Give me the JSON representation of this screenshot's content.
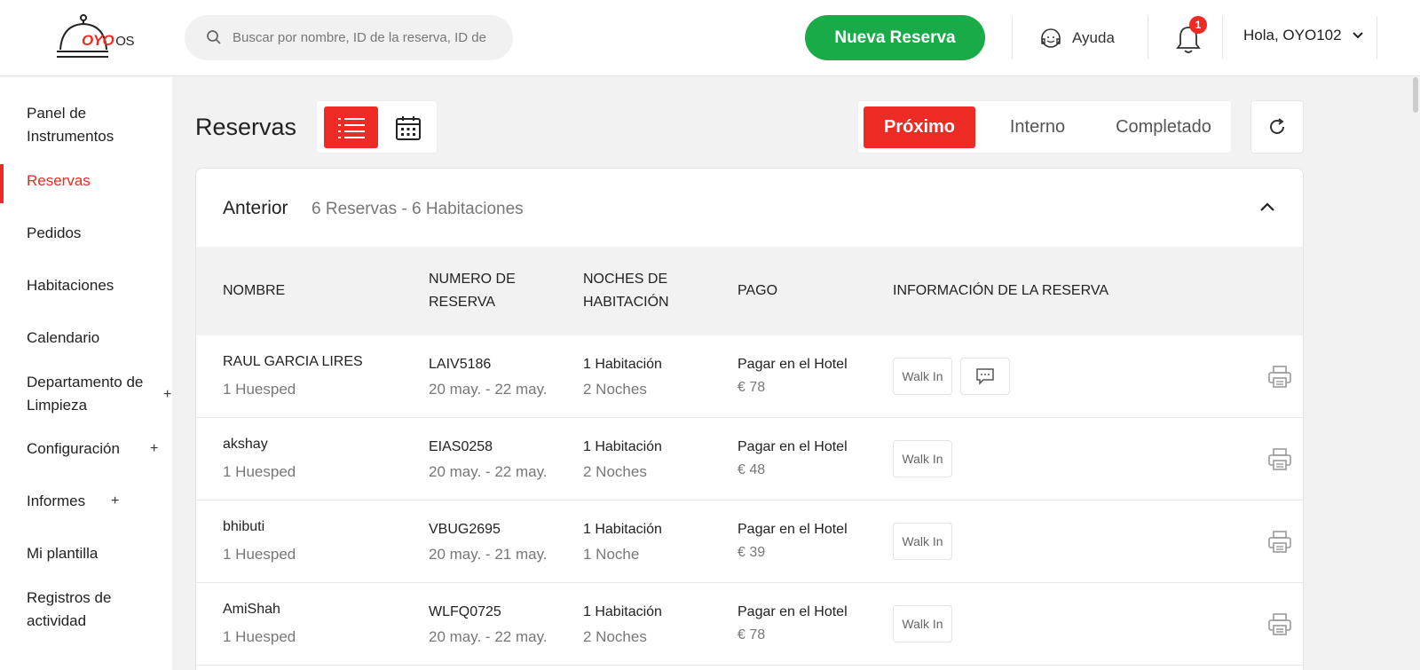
{
  "header": {
    "logo_brand": "OYO",
    "logo_suffix": "OS",
    "search_placeholder": "Buscar por nombre, ID de la reserva, ID de",
    "new_booking_label": "Nueva Reserva",
    "help_label": "Ayuda",
    "notification_count": "1",
    "user_greeting": "Hola, OYO102"
  },
  "sidebar": {
    "items": [
      {
        "label": "Panel de Instrumentos"
      },
      {
        "label": "Reservas"
      },
      {
        "label": "Pedidos"
      },
      {
        "label": "Habitaciones"
      },
      {
        "label": "Calendario"
      },
      {
        "label": "Departamento de Limpieza",
        "expand": "+"
      },
      {
        "label": "Configuración",
        "expand": "+"
      },
      {
        "label": "Informes",
        "expand": "+"
      },
      {
        "label": "Mi plantilla"
      },
      {
        "label": "Registros de actividad"
      }
    ]
  },
  "main": {
    "title": "Reservas",
    "tabs": [
      "Próximo",
      "Interno",
      "Completado"
    ],
    "section_title": "Anterior",
    "section_summary": "6 Reservas - 6 Habitaciones",
    "columns": [
      "NOMBRE",
      "NUMERO DE RESERVA",
      "NOCHES DE HABITACIÓN",
      "PAGO",
      "INFORMACIÓN DE LA RESERVA"
    ],
    "rows": [
      {
        "name": "RAUL GARCIA LIRES",
        "guests": "1 Huesped",
        "id": "LAIV5186",
        "dates": "20 may. - 22 may.",
        "rooms": "1 Habitación",
        "nights": "2 Noches",
        "payment": "Pagar en el Hotel",
        "amount": "€ 78",
        "tag": "Walk In",
        "has_chat": true
      },
      {
        "name": "akshay",
        "guests": "1 Huesped",
        "id": "EIAS0258",
        "dates": "20 may. - 22 may.",
        "rooms": "1 Habitación",
        "nights": "2 Noches",
        "payment": "Pagar en el Hotel",
        "amount": "€ 48",
        "tag": "Walk In",
        "has_chat": false
      },
      {
        "name": "bhibuti",
        "guests": "1 Huesped",
        "id": "VBUG2695",
        "dates": "20 may. - 21 may.",
        "rooms": "1 Habitación",
        "nights": "1 Noche",
        "payment": "Pagar en el Hotel",
        "amount": "€ 39",
        "tag": "Walk In",
        "has_chat": false
      },
      {
        "name": "AmiShah",
        "guests": "1 Huesped",
        "id": "WLFQ0725",
        "dates": "20 may. - 22 may.",
        "rooms": "1 Habitación",
        "nights": "2 Noches",
        "payment": "Pagar en el Hotel",
        "amount": "€ 78",
        "tag": "Walk In",
        "has_chat": false
      }
    ]
  },
  "colors": {
    "accent": "#ee2a24",
    "primary_button": "#1aab49"
  }
}
